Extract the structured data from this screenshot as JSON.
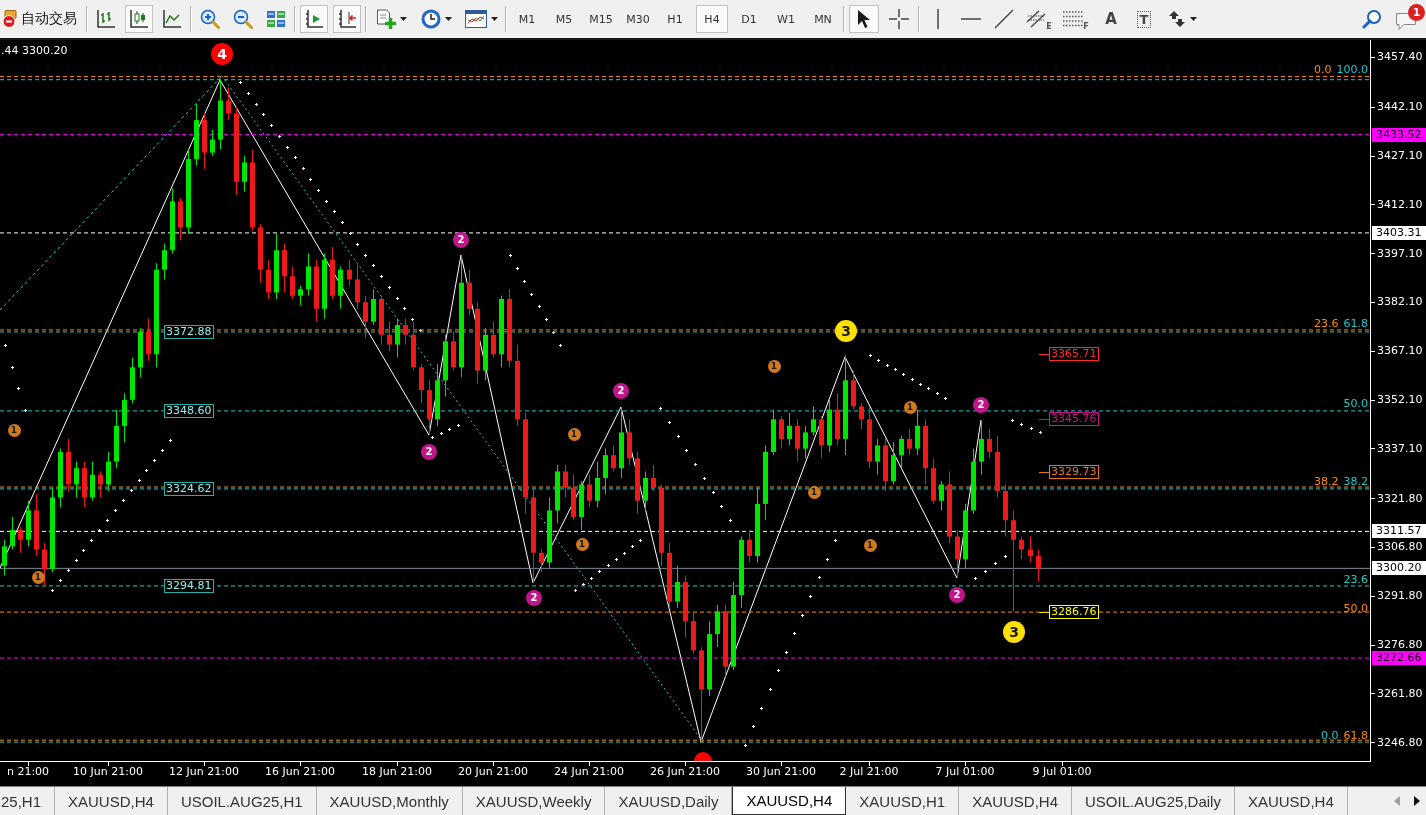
{
  "toolbar": {
    "groups": [
      {
        "buttons": [
          {
            "kind": "auto-trading",
            "label": "自动交易",
            "selected": false
          }
        ]
      },
      {
        "buttons": [
          {
            "kind": "bar-chart",
            "selected": false
          },
          {
            "kind": "candlesticks",
            "selected": true
          },
          {
            "kind": "line-chart",
            "selected": false
          }
        ]
      },
      {
        "buttons": [
          {
            "kind": "zoom-in",
            "selected": false
          },
          {
            "kind": "zoom-out",
            "selected": false
          },
          {
            "kind": "tile-windows",
            "selected": false
          }
        ]
      },
      {
        "buttons": [
          {
            "kind": "auto-scroll",
            "selected": true
          },
          {
            "kind": "chart-shift",
            "selected": true
          }
        ]
      },
      {
        "buttons": [
          {
            "kind": "indicators",
            "selected": false
          },
          {
            "kind": "periods",
            "selected": false
          },
          {
            "kind": "templates",
            "selected": false
          }
        ]
      },
      {
        "buttons": [
          {
            "kind": "timeframe",
            "label": "M1",
            "selected": false
          },
          {
            "kind": "timeframe",
            "label": "M5",
            "selected": false
          },
          {
            "kind": "timeframe",
            "label": "M15",
            "selected": false
          },
          {
            "kind": "timeframe",
            "label": "M30",
            "selected": false
          },
          {
            "kind": "timeframe",
            "label": "H1",
            "selected": false
          },
          {
            "kind": "timeframe",
            "label": "H4",
            "selected": true
          },
          {
            "kind": "timeframe",
            "label": "D1",
            "selected": false
          },
          {
            "kind": "timeframe",
            "label": "W1",
            "selected": false
          },
          {
            "kind": "timeframe",
            "label": "MN",
            "selected": false
          }
        ]
      },
      {
        "buttons": [
          {
            "kind": "cursor",
            "selected": true
          },
          {
            "kind": "crosshair",
            "selected": false
          }
        ]
      },
      {
        "buttons": [
          {
            "kind": "vertical-line",
            "selected": false
          },
          {
            "kind": "horizontal-line",
            "selected": false
          },
          {
            "kind": "trendline",
            "selected": false
          },
          {
            "kind": "fib-channel",
            "label": "E",
            "selected": false
          },
          {
            "kind": "fib-retracement",
            "label": "F",
            "selected": false
          },
          {
            "kind": "text",
            "label": "A",
            "selected": false
          },
          {
            "kind": "text-label",
            "label": "T",
            "selected": false
          },
          {
            "kind": "arrows",
            "selected": false
          }
        ]
      }
    ],
    "right": [
      {
        "kind": "search"
      },
      {
        "kind": "chat",
        "badge": "1"
      }
    ]
  },
  "chart": {
    "info": ".44 3300.20",
    "chart_data": {
      "type": "candlestick",
      "ylim": [
        3241.0,
        3462.6
      ],
      "yticks": [
        {
          "value": 3457.4,
          "label": "3457.40"
        },
        {
          "value": 3442.1,
          "label": "3442.10"
        },
        {
          "value": 3427.1,
          "label": "3427.10"
        },
        {
          "value": 3412.1,
          "label": "3412.10"
        },
        {
          "value": 3397.1,
          "label": "3397.10"
        },
        {
          "value": 3382.1,
          "label": "3382.10"
        },
        {
          "value": 3367.1,
          "label": "3367.10"
        },
        {
          "value": 3352.1,
          "label": "3352.10"
        },
        {
          "value": 3337.1,
          "label": "3337.10"
        },
        {
          "value": 3321.8,
          "label": "3321.80"
        },
        {
          "value": 3306.8,
          "label": "3306.80"
        },
        {
          "value": 3291.8,
          "label": "3291.80"
        },
        {
          "value": 3276.8,
          "label": "3276.80"
        },
        {
          "value": 3261.8,
          "label": "3261.80"
        },
        {
          "value": 3246.8,
          "label": "3246.80"
        }
      ],
      "categories": [
        null,
        null,
        null,
        "n 21:00",
        null,
        null,
        null,
        null,
        null,
        null,
        null,
        null,
        null,
        "10 Jun 21:00",
        null,
        null,
        null,
        null,
        null,
        null,
        null,
        null,
        null,
        null,
        null,
        "12 Jun 21:00",
        null,
        null,
        null,
        null,
        null,
        null,
        null,
        null,
        null,
        null,
        null,
        "16 Jun 21:00",
        null,
        null,
        null,
        null,
        null,
        null,
        null,
        null,
        null,
        null,
        null,
        "18 Jun 21:00",
        null,
        null,
        null,
        null,
        null,
        null,
        null,
        null,
        null,
        null,
        null,
        "20 Jun 21:00",
        null,
        null,
        null,
        null,
        null,
        null,
        null,
        null,
        null,
        null,
        null,
        "24 Jun 21:00",
        null,
        null,
        null,
        null,
        null,
        null,
        null,
        null,
        null,
        null,
        null,
        "26 Jun 21:00",
        null,
        null,
        null,
        null,
        null,
        null,
        null,
        null,
        null,
        null,
        null,
        "30 Jun 21:00",
        null,
        null,
        null,
        null,
        null,
        null,
        null,
        null,
        null,
        null,
        "2 Jul 21:00",
        null,
        null,
        null,
        null,
        null,
        null,
        null,
        null,
        null,
        null,
        null,
        "7 Jul 01:00",
        null,
        null,
        null,
        null,
        null,
        null,
        null,
        null,
        null,
        null,
        null,
        "9 Jul 01:00",
        null,
        null,
        null,
        null,
        null,
        null,
        null,
        null,
        null,
        null,
        null,
        null,
        null,
        null,
        null,
        null,
        null,
        null,
        null,
        null,
        null,
        null,
        null,
        null,
        null,
        null,
        null,
        null,
        null,
        null,
        null,
        null,
        null,
        null,
        null,
        null,
        null,
        null
      ],
      "ohlc": [
        [
          3301,
          3309,
          3298,
          3307
        ],
        [
          3307,
          3316,
          3306,
          3312
        ],
        [
          3312,
          3313,
          3305,
          3309
        ],
        [
          3309,
          3321,
          3307,
          3318
        ],
        [
          3318,
          3323,
          3304,
          3306
        ],
        [
          3306,
          3308,
          3295,
          3300
        ],
        [
          3300,
          3325,
          3299,
          3322
        ],
        [
          3322,
          3337,
          3319,
          3336
        ],
        [
          3336,
          3340,
          3324,
          3326
        ],
        [
          3326,
          3333,
          3322,
          3331
        ],
        [
          3331,
          3333,
          3319,
          3322
        ],
        [
          3322,
          3333,
          3321,
          3329
        ],
        [
          3329,
          3330,
          3322,
          3326
        ],
        [
          3326,
          3336,
          3324,
          3333
        ],
        [
          3333,
          3349,
          3331,
          3344
        ],
        [
          3344,
          3354,
          3339,
          3352
        ],
        [
          3352,
          3365,
          3351,
          3362
        ],
        [
          3362,
          3374,
          3359,
          3373
        ],
        [
          3373,
          3377,
          3364,
          3366
        ],
        [
          3366,
          3394,
          3362,
          3392
        ],
        [
          3392,
          3400,
          3389,
          3398
        ],
        [
          3398,
          3417,
          3397,
          3413
        ],
        [
          3413,
          3414,
          3401,
          3405
        ],
        [
          3405,
          3429,
          3403,
          3426
        ],
        [
          3426,
          3443,
          3424,
          3438
        ],
        [
          3438,
          3440,
          3423,
          3428
        ],
        [
          3428,
          3435,
          3427,
          3432
        ],
        [
          3432,
          3450.4,
          3429,
          3444
        ],
        [
          3444,
          3448,
          3438,
          3440
        ],
        [
          3440,
          3442,
          3415,
          3419
        ],
        [
          3419,
          3427,
          3416,
          3425
        ],
        [
          3425,
          3429,
          3404,
          3405
        ],
        [
          3405,
          3406,
          3388,
          3392
        ],
        [
          3392,
          3395,
          3383,
          3385
        ],
        [
          3385,
          3403,
          3383,
          3398
        ],
        [
          3398,
          3400,
          3385,
          3390
        ],
        [
          3390,
          3393,
          3383,
          3384
        ],
        [
          3384,
          3387,
          3381,
          3386
        ],
        [
          3386,
          3397,
          3384,
          3393
        ],
        [
          3393,
          3395,
          3376,
          3380
        ],
        [
          3380,
          3397,
          3377,
          3395
        ],
        [
          3395,
          3399,
          3383,
          3384
        ],
        [
          3384,
          3393,
          3380,
          3392
        ],
        [
          3392,
          3395,
          3387,
          3389
        ],
        [
          3389,
          3394,
          3380,
          3382
        ],
        [
          3382,
          3384,
          3371,
          3376
        ],
        [
          3376,
          3386,
          3375,
          3383
        ],
        [
          3383,
          3384,
          3369,
          3372
        ],
        [
          3372,
          3376,
          3367,
          3369
        ],
        [
          3369,
          3377,
          3365,
          3375
        ],
        [
          3375,
          3377,
          3369,
          3372
        ],
        [
          3372,
          3376,
          3361,
          3362
        ],
        [
          3362,
          3363,
          3351,
          3355
        ],
        [
          3355,
          3358,
          3341.2,
          3346
        ],
        [
          3346,
          3363,
          3344,
          3358
        ],
        [
          3358,
          3372,
          3353,
          3370
        ],
        [
          3370,
          3373,
          3361,
          3362
        ],
        [
          3362,
          3396.5,
          3359,
          3388
        ],
        [
          3388,
          3392,
          3378,
          3380
        ],
        [
          3380,
          3382,
          3357,
          3361
        ],
        [
          3361,
          3374,
          3358,
          3372
        ],
        [
          3372,
          3376,
          3365,
          3366
        ],
        [
          3366,
          3384,
          3362,
          3383
        ],
        [
          3383,
          3386,
          3362,
          3364
        ],
        [
          3364,
          3369,
          3344,
          3346
        ],
        [
          3346,
          3348,
          3317,
          3322
        ],
        [
          3322,
          3325,
          3295.7,
          3305
        ],
        [
          3305,
          3306,
          3299,
          3302
        ],
        [
          3302,
          3322,
          3300,
          3318
        ],
        [
          3318,
          3332,
          3314,
          3330
        ],
        [
          3330,
          3332,
          3322,
          3325
        ],
        [
          3325,
          3329,
          3315,
          3316
        ],
        [
          3316,
          3327,
          3312,
          3326
        ],
        [
          3326,
          3329,
          3319,
          3321
        ],
        [
          3321,
          3333,
          3319,
          3328
        ],
        [
          3328,
          3337,
          3323,
          3335
        ],
        [
          3335,
          3338,
          3330,
          3331
        ],
        [
          3331,
          3349.8,
          3328,
          3342
        ],
        [
          3342,
          3346,
          3332,
          3334
        ],
        [
          3334,
          3336,
          3317,
          3321
        ],
        [
          3321,
          3330,
          3318,
          3328
        ],
        [
          3328,
          3332,
          3324,
          3325
        ],
        [
          3325,
          3326,
          3301,
          3305
        ],
        [
          3305,
          3308,
          3288,
          3290
        ],
        [
          3290,
          3301,
          3288,
          3296
        ],
        [
          3296,
          3298,
          3279,
          3284
        ],
        [
          3284,
          3287,
          3274,
          3275
        ],
        [
          3275,
          3276,
          3246.8,
          3263
        ],
        [
          3263,
          3284,
          3261,
          3280
        ],
        [
          3280,
          3289,
          3276,
          3287
        ],
        [
          3287,
          3289,
          3267,
          3270
        ],
        [
          3270,
          3296,
          3269,
          3292
        ],
        [
          3292,
          3310,
          3288,
          3309
        ],
        [
          3309,
          3312,
          3302,
          3304
        ],
        [
          3304,
          3325,
          3302,
          3320
        ],
        [
          3320,
          3338,
          3315,
          3336
        ],
        [
          3336,
          3349,
          3335,
          3346
        ],
        [
          3346,
          3347,
          3337,
          3340
        ],
        [
          3340,
          3348,
          3338,
          3344
        ],
        [
          3344,
          3346,
          3333,
          3337
        ],
        [
          3337,
          3344,
          3334,
          3342
        ],
        [
          3342,
          3350,
          3341,
          3346
        ],
        [
          3346,
          3347,
          3334,
          3338
        ],
        [
          3338,
          3352,
          3336,
          3349
        ],
        [
          3349,
          3354,
          3338,
          3340
        ],
        [
          3340,
          3365.7,
          3335,
          3358
        ],
        [
          3358,
          3361,
          3349,
          3350
        ],
        [
          3350,
          3351,
          3343,
          3346
        ],
        [
          3346,
          3350,
          3331,
          3333
        ],
        [
          3333,
          3340,
          3329,
          3338
        ],
        [
          3338,
          3340,
          3324,
          3327
        ],
        [
          3327,
          3339,
          3326,
          3335
        ],
        [
          3335,
          3341,
          3331,
          3340
        ],
        [
          3340,
          3343,
          3335,
          3337
        ],
        [
          3337,
          3349,
          3335,
          3344
        ],
        [
          3344,
          3346,
          3326,
          3331
        ],
        [
          3331,
          3334,
          3320,
          3321
        ],
        [
          3321,
          3327,
          3318,
          3326
        ],
        [
          3326,
          3330,
          3308,
          3310
        ],
        [
          3310,
          3312,
          3297.2,
          3303
        ],
        [
          3303,
          3320,
          3300,
          3318
        ],
        [
          3318,
          3337,
          3317,
          3333
        ],
        [
          3333,
          3345.8,
          3329,
          3340
        ],
        [
          3340,
          3343,
          3334,
          3336
        ],
        [
          3336,
          3341,
          3322,
          3324
        ],
        [
          3324,
          3326,
          3310,
          3315
        ],
        [
          3315,
          3318,
          3286.8,
          3309
        ],
        [
          3309,
          3310,
          3303,
          3306
        ],
        [
          3306,
          3310,
          3302,
          3304
        ],
        [
          3304,
          3306,
          3296.2,
          3300.2
        ],
        null,
        null,
        null,
        null,
        null,
        null,
        null,
        null,
        null,
        null,
        null,
        null,
        null,
        null,
        null,
        null,
        null,
        null,
        null,
        null,
        null,
        null,
        null,
        null,
        null,
        null,
        null,
        null,
        null,
        null,
        null,
        null,
        null,
        null,
        null,
        null,
        null,
        null,
        null,
        null,
        null
      ],
      "ref_lines": [
        {
          "axis": "y",
          "value": 3433.52,
          "color": "#ff00ff"
        },
        {
          "axis": "y",
          "value": 3403.31,
          "color": "#ffffff"
        },
        {
          "axis": "y",
          "value": 3311.57,
          "color": "#ffffff"
        },
        {
          "axis": "y",
          "value": 3300.2,
          "color": "#7a8a9a"
        },
        {
          "axis": "y",
          "value": 3272.66,
          "color": "#ff00ff"
        },
        {
          "axis": "y",
          "value": 3450.4,
          "color": "#20c8c8"
        },
        {
          "axis": "y",
          "value": 3372.88,
          "color": "#20c8c8"
        },
        {
          "axis": "y",
          "value": 3348.6,
          "color": "#20c8c8"
        },
        {
          "axis": "y",
          "value": 3324.62,
          "color": "#20c8c8"
        },
        {
          "axis": "y",
          "value": 3294.81,
          "color": "#20c8c8"
        },
        {
          "axis": "y",
          "value": 3246.8,
          "color": "#20c8c8"
        },
        {
          "axis": "y",
          "value": 3451.4,
          "color": "#ff8c00"
        },
        {
          "axis": "y",
          "value": 3373.5,
          "color": "#ff8c00"
        },
        {
          "axis": "y",
          "value": 3325.2,
          "color": "#ff8c00"
        },
        {
          "axis": "y",
          "value": 3286.76,
          "color": "#ff8c00"
        },
        {
          "axis": "y",
          "value": 3247.4,
          "color": "#ff8c00"
        }
      ]
    },
    "price_tags": [
      {
        "text": "3433.52",
        "color": "#ff00ff"
      },
      {
        "text": "3403.31",
        "color": "#ffffff"
      },
      {
        "text": "3311.57",
        "color": "#ffffff"
      },
      {
        "text": "3300.20",
        "color": "#ffffff"
      },
      {
        "text": "3272.66",
        "color": "#ff00ff"
      }
    ],
    "fib_levels": [
      {
        "labels": [
          {
            "text": "0.0",
            "color": "#ff8c00"
          },
          {
            "text": "100.0",
            "color": "#20c8c8"
          }
        ]
      },
      {
        "labels": [
          {
            "text": "23.6",
            "color": "#ff8c00"
          },
          {
            "text": "61.8",
            "color": "#20c8c8"
          }
        ]
      },
      {
        "labels": [
          {
            "text": "50.0",
            "color": "#20c8c8"
          }
        ]
      },
      {
        "labels": [
          {
            "text": "38.2",
            "color": "#ff8c00"
          },
          {
            "text": "38.2",
            "color": "#20c8c8"
          }
        ]
      },
      {
        "labels": [
          {
            "text": "23.6",
            "color": "#20c8c8"
          }
        ]
      },
      {
        "labels": [
          {
            "text": "50.0",
            "color": "#ff8c00"
          }
        ]
      },
      {
        "labels": [
          {
            "text": "0.0",
            "color": "#20c8c8"
          },
          {
            "text": "61.8",
            "color": "#ff8c00"
          }
        ]
      }
    ],
    "fib_prices": [
      "3372.88",
      "3348.60",
      "3324.62",
      "3294.81"
    ],
    "targets": [
      {
        "text": "3365.71",
        "color": "#ff2a2a"
      },
      {
        "text": "3345.76",
        "color": "#c8148c"
      },
      {
        "text": "3329.73",
        "color": "#e8741e"
      },
      {
        "text": "3286.76",
        "color": "#ffff00"
      }
    ],
    "wave_markers": [
      {
        "label": "1",
        "color": "#d2781e"
      },
      {
        "label": "1",
        "color": "#d2781e"
      },
      {
        "label": "4",
        "color": "#ff0000"
      },
      {
        "label": "2",
        "color": "#c0168a"
      },
      {
        "label": "2",
        "color": "#c0168a"
      },
      {
        "label": "2",
        "color": "#c0168a"
      },
      {
        "label": "1",
        "color": "#d2781e"
      },
      {
        "label": "1",
        "color": "#d2781e"
      },
      {
        "label": "2",
        "color": "#c0168a"
      },
      {
        "color": "#ff0000"
      },
      {
        "label": "1",
        "color": "#d2781e"
      },
      {
        "label": "1",
        "color": "#d2781e"
      },
      {
        "label": "3",
        "color": "#ffe000"
      },
      {
        "label": "1",
        "color": "#d2781e"
      },
      {
        "label": "1",
        "color": "#d2781e"
      },
      {
        "label": "2",
        "color": "#c0168a"
      },
      {
        "label": "2",
        "color": "#c0168a"
      },
      {
        "label": "3",
        "color": "#ffe000"
      }
    ]
  },
  "tabs": [
    {
      "label": "25,H1",
      "selected": false
    },
    {
      "label": "XAUUSD,H4",
      "selected": false
    },
    {
      "label": "USOIL.AUG25,H1",
      "selected": false
    },
    {
      "label": "XAUUSD,Monthly",
      "selected": false
    },
    {
      "label": "XAUUSD,Weekly",
      "selected": false
    },
    {
      "label": "XAUUSD,Daily",
      "selected": false
    },
    {
      "label": "XAUUSD,H4",
      "selected": true
    },
    {
      "label": "XAUUSD,H1",
      "selected": false
    },
    {
      "label": "XAUUSD,H4",
      "selected": false
    },
    {
      "label": "USOIL.AUG25,Daily",
      "selected": false
    },
    {
      "label": "XAUUSD,H4",
      "selected": false
    }
  ]
}
